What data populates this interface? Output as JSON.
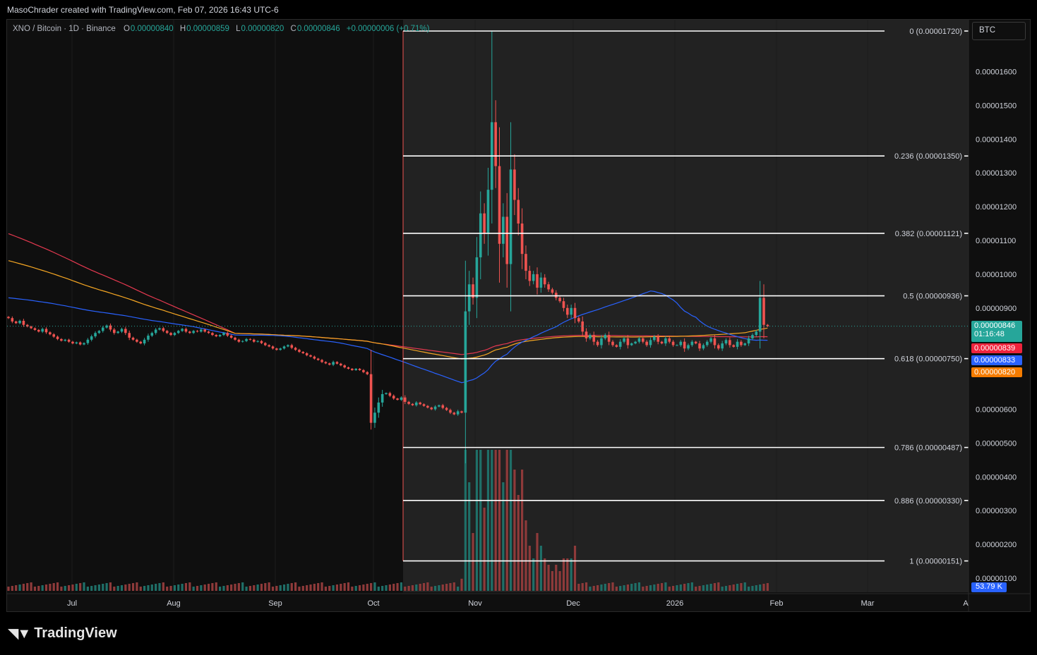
{
  "header": {
    "attribution": "MasoChrader created with TradingView.com, Feb 07, 2026 16:43 UTC-6"
  },
  "legend": {
    "symbol": "XNO / Bitcoin · 1D · Binance",
    "o_label": "O",
    "o_value": "0.00000840",
    "h_label": "H",
    "h_value": "0.00000859",
    "l_label": "L",
    "l_value": "0.00000820",
    "c_label": "C",
    "c_value": "0.00000846",
    "change": "+0.00000006 (+0.71%)"
  },
  "currency_box": "BTC",
  "brand": {
    "name": "TradingView"
  },
  "colors": {
    "up": "#26a69a",
    "down": "#ef5350",
    "ma_red": "#e53950",
    "ma_orange": "#f5a623",
    "ma_blue": "#2962ff",
    "fib_line": "#ffffff",
    "bg": "#0f0f0f",
    "highlight": "#222222"
  },
  "price_tags": {
    "last": "0.00000846",
    "countdown": "01:16:48",
    "ma_red": "0.00000839",
    "ma_blue": "0.00000833",
    "ma_orange": "0.00000820"
  },
  "volume_tag": "53.79 K",
  "chart_data": {
    "type": "candlestick",
    "title": "XNO / Bitcoin · 1D · Binance",
    "y_ticks": [
      "0.00001600",
      "0.00001500",
      "0.00001400",
      "0.00001300",
      "0.00001200",
      "0.00001100",
      "0.00001000",
      "0.00000900",
      "0.00000600",
      "0.00000500",
      "0.00000400",
      "0.00000300",
      "0.00000200",
      "0.00000100"
    ],
    "y_tick_values": [
      1.6e-05,
      1.5e-05,
      1.4e-05,
      1.3e-05,
      1.2e-05,
      1.1e-05,
      1e-05,
      9e-06,
      6e-06,
      5e-06,
      4e-06,
      3e-06,
      2e-06,
      1e-06
    ],
    "ylim": [
      8e-07,
      1.74e-05
    ],
    "x_ticks": [
      "Jul",
      "Aug",
      "Sep",
      "Oct",
      "Nov",
      "Dec",
      "2026",
      "Feb",
      "Mar",
      "A"
    ],
    "fib_levels": [
      {
        "label": "0 (0.00001720)",
        "value": 1.72e-05
      },
      {
        "label": "0.236 (0.00001350)",
        "value": 1.35e-05
      },
      {
        "label": "0.382 (0.00001121)",
        "value": 1.121e-05
      },
      {
        "label": "0.5 (0.00000936)",
        "value": 9.36e-06
      },
      {
        "label": "0.618 (0.00000750)",
        "value": 7.5e-06
      },
      {
        "label": "0.786 (0.00000487)",
        "value": 4.87e-06
      },
      {
        "label": "0.886 (0.00000330)",
        "value": 3.3e-06
      },
      {
        "label": "1 (0.00000151)",
        "value": 1.51e-06
      }
    ],
    "closes": [
      8.7e-06,
      8.6e-06,
      8.55e-06,
      8.62e-06,
      8.5e-06,
      8.45e-06,
      8.4e-06,
      8.35e-06,
      8.3e-06,
      8.38e-06,
      8.28e-06,
      8.22e-06,
      8.15e-06,
      8.08e-06,
      8.03e-06,
      8.06e-06,
      8e-06,
      7.95e-06,
      7.98e-06,
      7.92e-06,
      7.96e-06,
      8.06e-06,
      8.16e-06,
      8.26e-06,
      8.32e-06,
      8.42e-06,
      8.48e-06,
      8.36e-06,
      8.26e-06,
      8.3e-06,
      8.38e-06,
      8.26e-06,
      8.12e-06,
      8.06e-06,
      8e-06,
      7.95e-06,
      8.06e-06,
      8.18e-06,
      8.26e-06,
      8.36e-06,
      8.4e-06,
      8.32e-06,
      8.26e-06,
      8.2e-06,
      8.26e-06,
      8.32e-06,
      8.38e-06,
      8.3e-06,
      8.26e-06,
      8.32e-06,
      8.3e-06,
      8.36e-06,
      8.3e-06,
      8.26e-06,
      8.2e-06,
      8.16e-06,
      8.2e-06,
      8.26e-06,
      8.18e-06,
      8.12e-06,
      8.06e-06,
      8e-06,
      8.02e-06,
      8.08e-06,
      8.06e-06,
      8e-06,
      8.02e-06,
      7.96e-06,
      7.9e-06,
      7.86e-06,
      7.8e-06,
      7.76e-06,
      7.8e-06,
      7.86e-06,
      7.9e-06,
      7.82e-06,
      7.76e-06,
      7.7e-06,
      7.66e-06,
      7.6e-06,
      7.56e-06,
      7.5e-06,
      7.46e-06,
      7.4e-06,
      7.36e-06,
      7.32e-06,
      7.4e-06,
      7.35e-06,
      7.3e-06,
      7.24e-06,
      7.2e-06,
      7.16e-06,
      7.2e-06,
      7.16e-06,
      7.1e-06,
      7.04e-06,
      5.6e-06,
      5.9e-06,
      6.2e-06,
      6.45e-06,
      6.48e-06,
      6.4e-06,
      6.32e-06,
      6.28e-06,
      6.35e-06,
      6.22e-06,
      6.16e-06,
      6.12e-06,
      6.2e-06,
      6.15e-06,
      6.1e-06,
      6.05e-06,
      6e-06,
      6.08e-06,
      6.12e-06,
      6.04e-06,
      5.98e-06,
      5.9e-06,
      5.85e-06,
      5.94e-06,
      5.9e-06,
      8.9e-06,
      9.7e-06,
      9.3e-06,
      1.05e-05,
      1.18e-05,
      1.12e-05,
      1.25e-05,
      1.45e-05,
      1.32e-05,
      1.09e-05,
      1.17e-05,
      1.03e-05,
      1.31e-05,
      1.22e-05,
      1.15e-05,
      1.06e-05,
      1.01e-05,
      9.8e-06,
      1e-05,
      9.6e-06,
      9.9e-06,
      9.7e-06,
      9.55e-06,
      9.45e-06,
      9.3e-06,
      9.2e-06,
      9e-06,
      8.8e-06,
      9e-06,
      8.7e-06,
      8.6e-06,
      8.3e-06,
      8.1e-06,
      8.2e-06,
      8e-06,
      7.9e-06,
      8.1e-06,
      8.2e-06,
      8e-06,
      7.9e-06,
      7.85e-06,
      8e-06,
      8.1e-06,
      7.9e-06,
      7.95e-06,
      8e-06,
      8.1e-06,
      8e-06,
      7.9e-06,
      8.05e-06,
      8.15e-06,
      8e-06,
      7.95e-06,
      8.1e-06,
      8e-06,
      7.9e-06,
      7.9e-06,
      8e-06,
      7.8e-06,
      7.9e-06,
      8e-06,
      7.95e-06,
      7.8e-06,
      7.9e-06,
      8e-06,
      8.1e-06,
      7.9e-06,
      7.8e-06,
      7.95e-06,
      8.05e-06,
      7.9e-06,
      7.85e-06,
      8e-06,
      7.9e-06,
      7.95e-06,
      8.1e-06,
      8.2e-06,
      8.3e-06,
      9.3e-06,
      8.5e-06,
      8.46e-06
    ]
  }
}
